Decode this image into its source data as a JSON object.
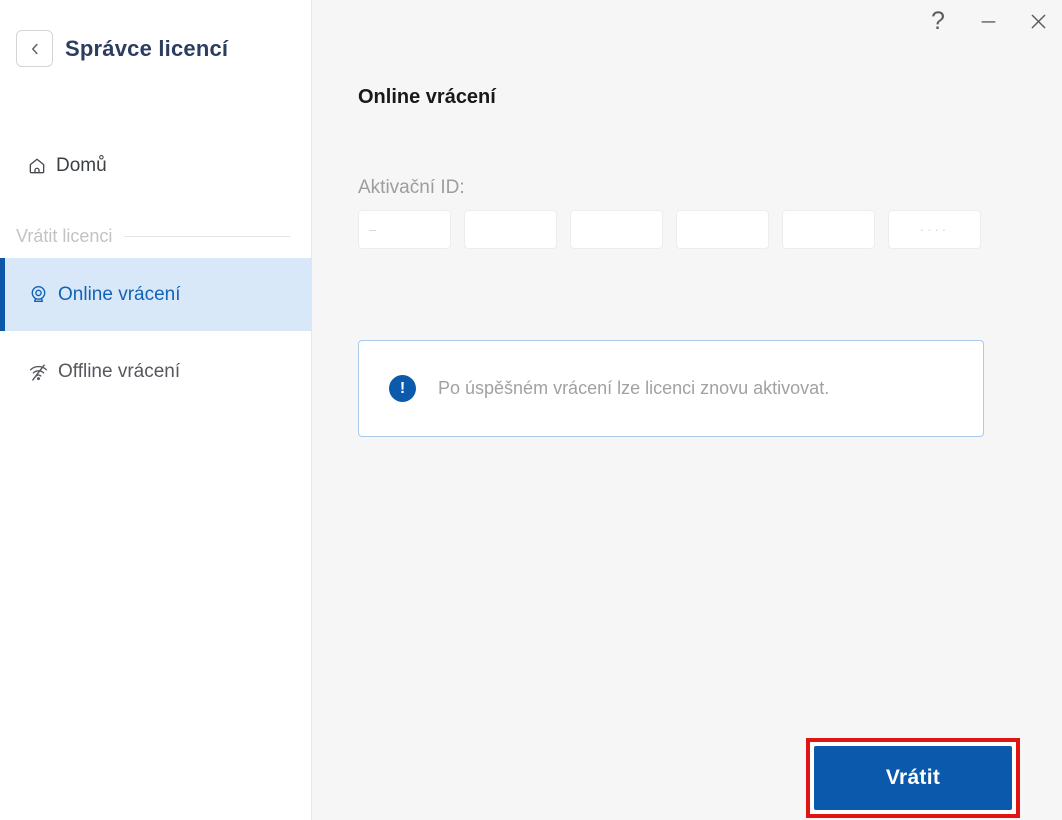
{
  "window": {
    "help": "?",
    "icons": {
      "help": "question-mark-icon",
      "minimize": "horizontal-line-icon",
      "close": "x-mark-icon"
    }
  },
  "sidebar": {
    "title": "Správce licencí",
    "home_label": "Domů",
    "section_label": "Vrátit licenci",
    "items": [
      {
        "label": "Online vrácení",
        "selected": true,
        "icon": "webcam-online-icon"
      },
      {
        "label": "Offline vrácení",
        "selected": false,
        "icon": "wifi-off-icon"
      }
    ]
  },
  "main": {
    "heading": "Online vrácení",
    "activation_label": "Aktivační ID:",
    "inputs": [
      {
        "value": "",
        "hint": "–"
      },
      {
        "value": "",
        "hint": ""
      },
      {
        "value": "",
        "hint": ""
      },
      {
        "value": "",
        "hint": ""
      },
      {
        "value": "",
        "hint": ""
      },
      {
        "value": "",
        "hint": "····"
      }
    ],
    "info_icon": "!",
    "info_text": "Po úspěšném vrácení lze licenci znovu aktivovat.",
    "button_label": "Vrátit"
  },
  "colors": {
    "accent_blue": "#0b59ac",
    "link_blue": "#1263b6",
    "selected_bg": "#d9e8f9",
    "title_navy": "#2c3e60",
    "info_border": "#a9cbe9",
    "annotation_red": "#e01414",
    "main_bg": "#f6f6f7"
  }
}
